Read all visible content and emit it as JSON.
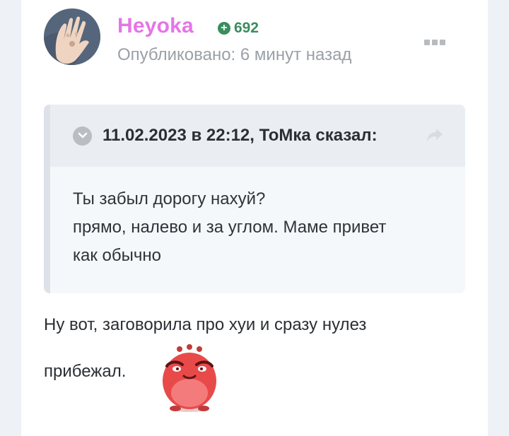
{
  "author": {
    "name": "Heyoka",
    "reputation": "692"
  },
  "post": {
    "meta": "Опубликовано: 6 минут назад",
    "content_line_1": "Ну вот, заговорила про хуи и сразу нулез",
    "content_line_2": "прибежал."
  },
  "quote": {
    "citation": "11.02.2023 в 22:12, ТоМка сказал:",
    "lines": [
      "Ты забыл дорогу нахуй?",
      "прямо, налево и за углом. Маме привет",
      "как обычно"
    ]
  },
  "icons": {
    "reputation": "plus-circle-icon",
    "menu": "more-dots-icon",
    "quote_toggle": "chevron-down-icon",
    "quote_share": "share-arrow-icon",
    "emoji": "red-blob-emoji"
  },
  "colors": {
    "author_name": "#e575e6",
    "reputation": "#3a8d5e",
    "meta_text": "#9aa0a6",
    "quote_bg": "#f5f8fb",
    "quote_header_bg": "#eaeef2",
    "quote_border": "#dde2e8"
  }
}
